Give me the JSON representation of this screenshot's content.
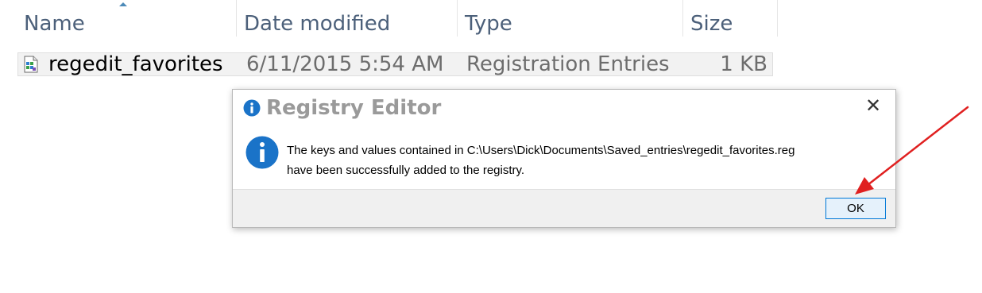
{
  "explorer": {
    "columns": {
      "name": "Name",
      "date_modified": "Date modified",
      "type": "Type",
      "size": "Size"
    },
    "files": [
      {
        "name": "regedit_favorites",
        "date_modified": "6/11/2015 5:54 AM",
        "type": "Registration Entries",
        "size": "1 KB",
        "icon": "registry-file-icon"
      }
    ]
  },
  "dialog": {
    "title": "Registry Editor",
    "close_label": "✕",
    "message_line1": "The keys and values contained in C:\\Users\\Dick\\Documents\\Saved_entries\\regedit_favorites.reg",
    "message_line2": "have been successfully added to the registry.",
    "ok_label": "OK",
    "icon": "info-icon"
  },
  "colors": {
    "accent": "#0078d7",
    "info_blue": "#1a73c8",
    "arrow_red": "#e02020",
    "header_text": "#4c607a"
  }
}
